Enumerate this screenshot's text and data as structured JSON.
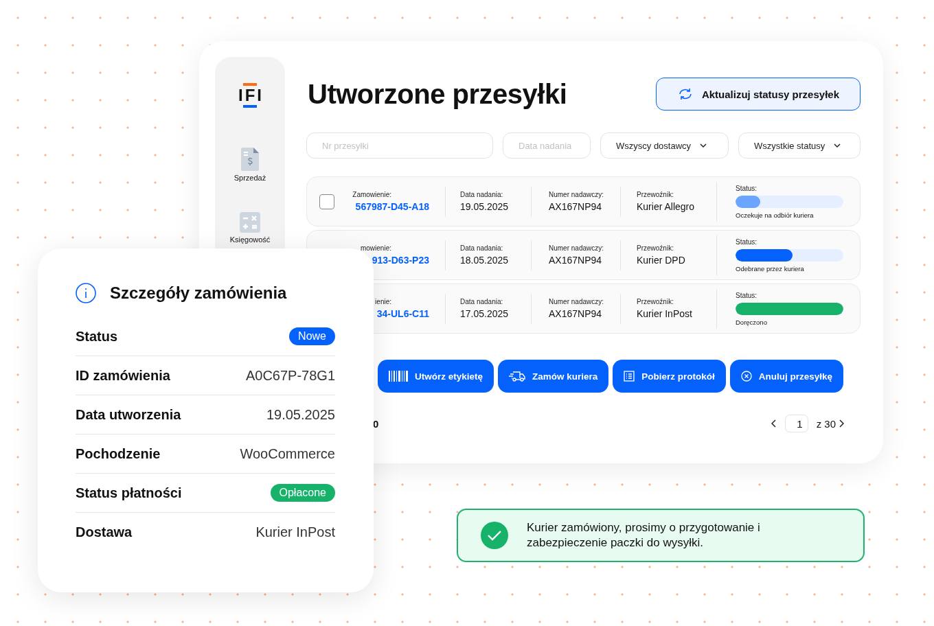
{
  "sidebar": {
    "logo": "IFI",
    "items": [
      {
        "label": "Sprzedaż",
        "kind": "sales"
      },
      {
        "label": "Księgowość",
        "kind": "accounting"
      }
    ]
  },
  "header": {
    "title": "Utworzone przesyłki",
    "refresh_button": "Aktualizuj statusy przesyłek"
  },
  "filters": {
    "shipment_number": {
      "placeholder": "Nr przesyłki"
    },
    "date": {
      "placeholder": "Data nadania"
    },
    "carriers": "Wszyscy dostawcy",
    "statuses": "Wszystkie statusy"
  },
  "shipments": [
    {
      "checked": false,
      "order_label": "Zamowienie:",
      "order": "567987-D45-A18",
      "date_label": "Data nadania:",
      "date": "19.05.2025",
      "number_label": "Numer nadawczy:",
      "number": "AX167NP94",
      "carrier_label": "Przewoźnik:",
      "carrier": "Kurier Allegro",
      "status_label": "Status:",
      "level": 0.23,
      "color": "#6aa5ff",
      "status": "Oczekuje na odbiór kuriera"
    },
    {
      "order_label": "mowienie:",
      "order": "913-D63-P23",
      "date_label": "Data nadania:",
      "date": "18.05.2025",
      "number_label": "Numer nadawczy:",
      "number": "AX167NP94",
      "carrier_label": "Przewoźnik:",
      "carrier": "Kurier DPD",
      "status_label": "Status:",
      "level": 0.53,
      "color": "#0561fc",
      "status": "Odebrane przez kuriera"
    },
    {
      "order_label": "ienie:",
      "order": "34-UL6-C11",
      "date_label": "Data nadania:",
      "date": "17.05.2025",
      "number_label": "Numer nadawczy:",
      "number": "AX167NP94",
      "carrier_label": "Przewoźnik:",
      "carrier": "Kurier InPost",
      "status_label": "Status:",
      "level": 1,
      "color": "#17b26a",
      "status": "Doręczono"
    }
  ],
  "actions": [
    {
      "label": "Utwórz etykietę",
      "kind": "barcode"
    },
    {
      "label": "Zamów kuriera",
      "kind": "truck"
    },
    {
      "label": "Pobierz protokół",
      "kind": "list"
    },
    {
      "label": "Anuluj przesyłkę",
      "kind": "cancel"
    }
  ],
  "pagination": {
    "total_fragment": "0",
    "page": "1",
    "of": "z 30"
  },
  "order_details": {
    "title": "Szczegóły zamówienia",
    "rows": [
      {
        "label": "Status",
        "value": "Nowe",
        "kind": "badge",
        "color": "#0561fc"
      },
      {
        "label": "ID zamówienia",
        "value": "A0C67P-78G1",
        "kind": "text"
      },
      {
        "label": "Data utworzenia",
        "value": "19.05.2025",
        "kind": "text"
      },
      {
        "label": "Pochodzenie",
        "value": "WooCommerce",
        "kind": "text"
      },
      {
        "label": "Status płatności",
        "value": "Opłacone",
        "kind": "badge",
        "color": "#17b26a"
      },
      {
        "label": "Dostawa",
        "value": "Kurier InPost",
        "kind": "text"
      }
    ]
  },
  "toast": {
    "message": "Kurier zamówiony, prosimy o przygotowanie i zabezpieczenie paczki do wysyłki."
  }
}
